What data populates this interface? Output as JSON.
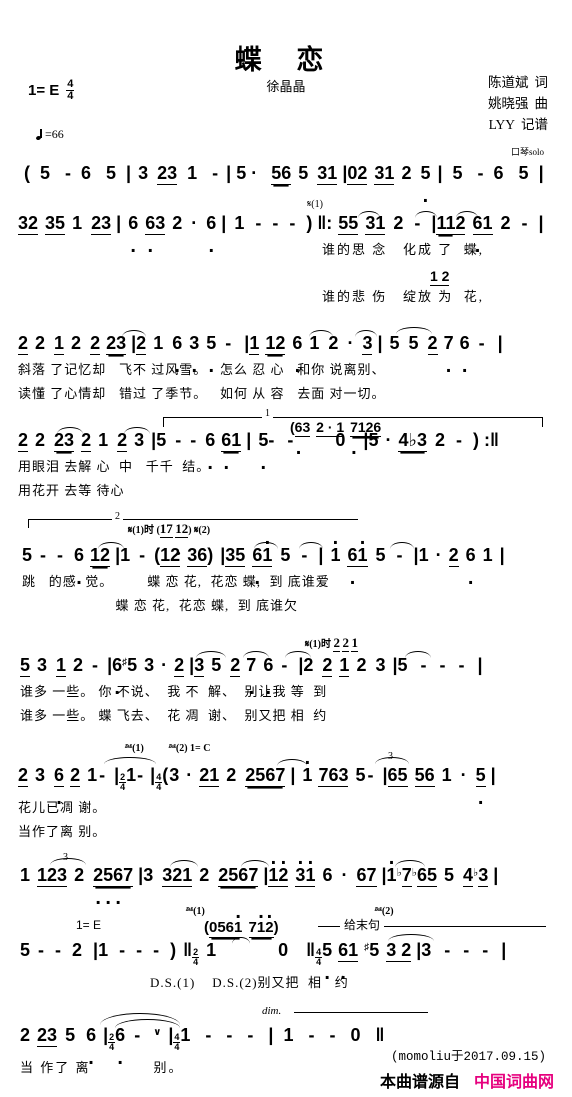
{
  "document": {
    "type": "jianpu-sheet-music",
    "title": "蝶  恋",
    "key_signature": "1= E",
    "time_signature": {
      "numerator": "4",
      "denominator": "4"
    },
    "tempo": "=66",
    "tempo_note": "quarter-note",
    "performer": "徐晶晶",
    "credits": [
      {
        "name": "陈道斌",
        "role": "词"
      },
      {
        "name": "姚晓强",
        "role": "曲"
      },
      {
        "name": "LYY",
        "role": "记谱"
      }
    ],
    "intro_label": "口琴solo"
  },
  "staves": [
    {
      "id": "line-1",
      "notes": "( 5  -  6 5 | 3 23 1  -  | 5 ·  56 5 31 | 02 31 2 5 | 5  -  6 5 |",
      "lyrics": []
    },
    {
      "id": "line-2",
      "notes": "32 35 1 23 | 6 63 2 · 6 | 1 - - - ) ‖: 55 31 2 - | 112 61 2 - |",
      "marks": [
        "𝄋(1)"
      ],
      "lyrics": [
        "谁的思 念   化成 了  蝶,",
        "谁的悲 伤   绽放 为  花,"
      ],
      "inner_note": "1 2"
    },
    {
      "id": "line-3",
      "notes": "2 2 1 2 2 23 | 2 1 6 3 5  -  | 1 12 6 1 2 · 3 | 5 5 2 7 6  -  |",
      "lyrics": [
        "斜落 了记忆却   飞不 过风雪。   怎么 忍 心   和你 说离别、",
        "读懂 了心情却   错过 了季节。   如何 从 容   去面 对一切。"
      ]
    },
    {
      "id": "line-4",
      "notes": "2 2 23 2 1 2 3 | 5 - - 6 61 | 5 -  -   0  | 5 · 4♭3 2  - ) :‖",
      "upper_note": "( 63 2 · 1 7126",
      "bracket": "1",
      "lyrics": [
        "用眼泪 去解 心  中   千千  结。",
        "用花开 去等 待心"
      ]
    },
    {
      "id": "line-5",
      "notes": "5 - - 6 12 | 1 - ( 12 36 ) | 35 61 5 - | 1 61 5 - | 1 · 2 6 1 |",
      "bracket": "2",
      "marks_small": "𝄋(1)时 ( 17 12 ) 𝄋(2)",
      "lyrics": [
        "跳   的感  觉。        蝶 恋 花,  花恋 蝶,  到 底谁爱",
        "                      蝶 恋 花,  花恋 蝶,  到 底谁欠"
      ]
    },
    {
      "id": "line-6",
      "notes": "53 12 - | 6 ♯53 · 2 | 35 27 6 - | 2 21 2 3 | 5 - - - |",
      "marks_small": "𝄋(1)时  2 2 1",
      "lyrics": [
        "谁多 一些。 你 不说、  我 不  解、  别让我 等  到",
        "谁多 一些。 蝶 飞去、  花 凋  谢、  别又把 相  约"
      ]
    },
    {
      "id": "line-7",
      "notes": "2 3 6 2 1 - | 2/4 1 - | 4/4 ( 3 · 21 2 2567 | 1 763 5 - | 65 56 1 · 5 |",
      "marks_small": "𝄉(1)    𝄉(2) 1= C",
      "lyrics": [
        "花儿已凋 谢。",
        "当作了离 别。"
      ]
    },
    {
      "id": "line-8",
      "notes": "1 123 2 2567 | 3 321 2 2567 | 12 31 6 · 67 | 1♭7♭65 5 4♭3 |",
      "triplet": "3",
      "lyrics": []
    },
    {
      "id": "line-9",
      "key_hint": "1= E",
      "upper_note": "( 0561 712 )",
      "upper_label": "给末句",
      "marks_small": "𝄉(1)        𝄉(2)",
      "notes": "5 - - 2 | 1 - - - ) ‖ 2/4 1    0  ‖ 4/4 5 61 ♯53 2 | 3 - - - |",
      "lyrics": [
        "D.S.(1)    D.S.(2)别又把  相   约"
      ]
    },
    {
      "id": "line-10",
      "notes": "2 23 5 6 | 2/4 6  - ∨ | 4/4 1  -  -  - | 1  -  -  0 ‖",
      "dynamic": "dim.",
      "lyrics": [
        "当 作了 离            别。"
      ]
    }
  ],
  "footer": {
    "author_note": "(momoliu于2017.09.15)",
    "source_label": "本曲谱源自",
    "site_name": "中国词曲网",
    "site_color": "#e6007e"
  }
}
